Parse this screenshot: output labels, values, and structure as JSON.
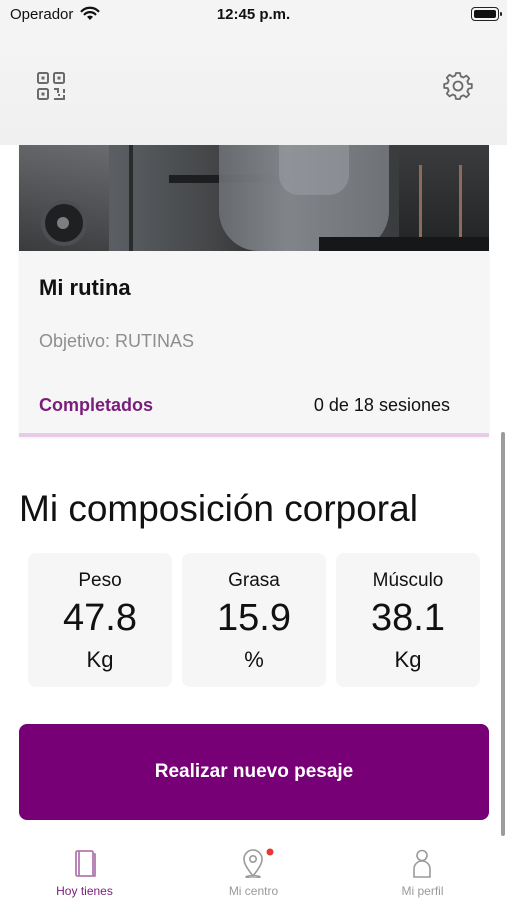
{
  "status_bar": {
    "carrier": "Operador",
    "time": "12:45 p.m."
  },
  "header": {
    "left_icon": "qr-code-icon",
    "right_icon": "gear-icon"
  },
  "routine_card": {
    "title": "Mi rutina",
    "objective": "Objetivo: RUTINAS",
    "progress_label": "Completados",
    "progress_value": "0 de 18 sesiones"
  },
  "composition": {
    "title": "Mi composición corporal",
    "metrics": [
      {
        "label": "Peso",
        "value": "47.8",
        "unit": "Kg"
      },
      {
        "label": "Grasa",
        "value": "15.9",
        "unit": "%"
      },
      {
        "label": "Músculo",
        "value": "38.1",
        "unit": "Kg"
      }
    ]
  },
  "action_button": {
    "label": "Realizar nuevo pesaje"
  },
  "tab_bar": {
    "tabs": [
      {
        "label": "Hoy tienes",
        "icon": "book-icon",
        "active": true
      },
      {
        "label": "Mi centro",
        "icon": "location-pin-icon",
        "active": false,
        "notification_dot": true
      },
      {
        "label": "Mi perfil",
        "icon": "person-icon",
        "active": false
      }
    ]
  },
  "colors": {
    "accent": "#770077",
    "progress_label": "#7a1d7a",
    "muted_text": "#8e8e8e",
    "inactive_tab": "#9a9a9a",
    "notification_dot": "#e53935"
  }
}
